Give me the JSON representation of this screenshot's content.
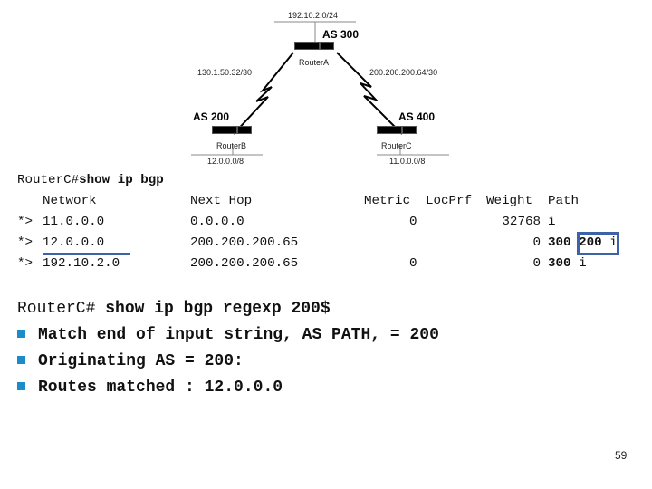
{
  "diagram": {
    "top_network": "192.10.2.0/24",
    "router_a": {
      "name": "RouterA",
      "as": "AS 300"
    },
    "router_b": {
      "name": "RouterB",
      "as": "AS 200",
      "network": "12.0.0.0/8"
    },
    "router_c": {
      "name": "RouterC",
      "as": "AS 400",
      "network": "11.0.0.0/8"
    },
    "link_ab": "130.1.50.32/30",
    "link_ac": "200.200.200.64/30"
  },
  "bgp_table": {
    "prompt": "RouterC#",
    "command": "show ip bgp",
    "headers": {
      "network": "Network",
      "next_hop": "Next Hop",
      "metric": "Metric",
      "locprf": "LocPrf",
      "weight": "Weight",
      "path": "Path"
    },
    "rows": [
      {
        "status": "*>",
        "network": "11.0.0.0",
        "next_hop": "0.0.0.0",
        "metric": "0",
        "locprf": "",
        "weight": "32768",
        "path_as": "",
        "path_as2": "",
        "origin": "i"
      },
      {
        "status": "*>",
        "network": "12.0.0.0",
        "next_hop": "200.200.200.65",
        "metric": "",
        "locprf": "",
        "weight": "0",
        "path_as": "300",
        "path_as2": "200",
        "origin": "i"
      },
      {
        "status": "*>",
        "network": "192.10.2.0",
        "next_hop": "200.200.200.65",
        "metric": "0",
        "locprf": "",
        "weight": "0",
        "path_as": "300",
        "path_as2": "",
        "origin": "i"
      }
    ]
  },
  "regexp": {
    "prompt": "RouterC#",
    "command": " show ip bgp regexp 200$",
    "bullets": [
      "Match end of input string, AS_PATH, = 200",
      "Originating AS = 200:",
      "Routes matched : 12.0.0.0"
    ]
  },
  "colors": {
    "highlight": "#3d62a8",
    "bullet": "#1a8cc8"
  },
  "page_number": "59"
}
